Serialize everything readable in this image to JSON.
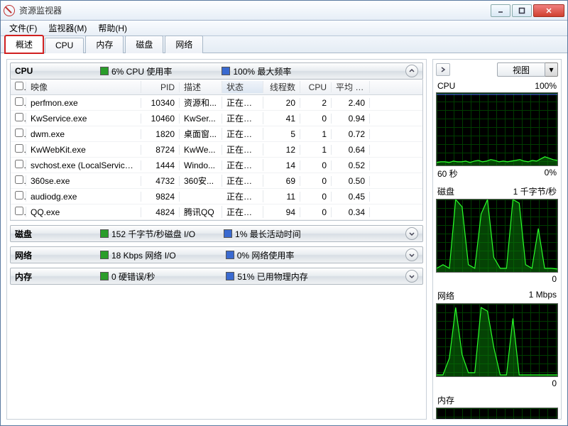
{
  "window": {
    "title": "资源监视器"
  },
  "menu": {
    "file": "文件(F)",
    "monitor": "监视器(M)",
    "help": "帮助(H)"
  },
  "tabs": {
    "overview": "概述",
    "cpu": "CPU",
    "memory": "内存",
    "disk": "磁盘",
    "network": "网络"
  },
  "cpu_section": {
    "name": "CPU",
    "usage_label": "6% CPU 使用率",
    "freq_label": "100% 最大频率",
    "columns": {
      "image": "映像",
      "pid": "PID",
      "desc": "描述",
      "status": "状态",
      "threads": "线程数",
      "cpu": "CPU",
      "avg": "平均 C..."
    },
    "rows": [
      {
        "image": "perfmon.exe",
        "pid": "10340",
        "desc": "资源和...",
        "status": "正在运行",
        "threads": "20",
        "cpu": "2",
        "avg": "2.40"
      },
      {
        "image": "KwService.exe",
        "pid": "10460",
        "desc": "KwSer...",
        "status": "正在运行",
        "threads": "41",
        "cpu": "0",
        "avg": "0.94"
      },
      {
        "image": "dwm.exe",
        "pid": "1820",
        "desc": "桌面窗...",
        "status": "正在运行",
        "threads": "5",
        "cpu": "1",
        "avg": "0.72"
      },
      {
        "image": "KwWebKit.exe",
        "pid": "8724",
        "desc": "KwWe...",
        "status": "正在运行",
        "threads": "12",
        "cpu": "1",
        "avg": "0.64"
      },
      {
        "image": "svchost.exe (LocalServiceN...",
        "pid": "1444",
        "desc": "Windo...",
        "status": "正在运行",
        "threads": "14",
        "cpu": "0",
        "avg": "0.52"
      },
      {
        "image": "360se.exe",
        "pid": "4732",
        "desc": "360安...",
        "status": "正在运行",
        "threads": "69",
        "cpu": "0",
        "avg": "0.50"
      },
      {
        "image": "audiodg.exe",
        "pid": "9824",
        "desc": "",
        "status": "正在运行",
        "threads": "11",
        "cpu": "0",
        "avg": "0.45"
      },
      {
        "image": "QQ.exe",
        "pid": "4824",
        "desc": "腾讯QQ",
        "status": "正在运行",
        "threads": "94",
        "cpu": "0",
        "avg": "0.34"
      }
    ]
  },
  "disk_section": {
    "name": "磁盘",
    "io_label": "152 千字节/秒磁盘 I/O",
    "active_label": "1% 最长活动时间"
  },
  "net_section": {
    "name": "网络",
    "io_label": "18 Kbps 网络 I/O",
    "use_label": "0% 网络使用率"
  },
  "mem_section": {
    "name": "内存",
    "fault_label": "0 硬错误/秒",
    "used_label": "51% 已用物理内存"
  },
  "right": {
    "view_label": "视图",
    "graphs": {
      "cpu": {
        "title": "CPU",
        "right": "100%",
        "foot_l": "60 秒",
        "foot_r": "0%"
      },
      "disk": {
        "title": "磁盘",
        "right": "1 千字节/秒",
        "foot_l": "",
        "foot_r": "0"
      },
      "net": {
        "title": "网络",
        "right": "1 Mbps",
        "foot_l": "",
        "foot_r": "0"
      },
      "mem": {
        "title": "内存",
        "right": ""
      }
    }
  },
  "chart_data": [
    {
      "type": "line",
      "title": "CPU",
      "ylim": [
        0,
        100
      ],
      "xrange_seconds": 60,
      "series": [
        {
          "name": "CPU 使用率",
          "values": [
            4,
            5,
            5,
            4,
            6,
            5,
            5,
            6,
            4,
            6,
            7,
            5,
            6,
            8,
            7,
            5,
            6,
            5,
            6,
            7,
            8,
            6,
            5,
            7,
            6,
            9,
            12,
            10,
            8,
            7
          ]
        },
        {
          "name": "最大频率",
          "values": [
            100,
            100,
            100,
            100,
            100,
            100,
            100,
            100,
            100,
            100,
            100,
            100,
            100,
            100,
            100,
            100,
            100,
            100,
            100,
            100,
            100,
            100,
            100,
            100,
            100,
            100,
            100,
            100,
            100,
            100
          ]
        }
      ]
    },
    {
      "type": "line",
      "title": "磁盘",
      "ylabel": "千字节/秒",
      "ylim": [
        0,
        1
      ],
      "series": [
        {
          "name": "磁盘 I/O",
          "values": [
            0.05,
            0.1,
            0.05,
            1.0,
            0.9,
            0.1,
            0.05,
            0.8,
            1.0,
            0.2,
            0.05,
            0.05,
            1.0,
            0.95,
            0.1,
            0.05,
            0.6,
            0.05,
            0.05,
            0.04
          ]
        }
      ]
    },
    {
      "type": "line",
      "title": "网络",
      "ylabel": "Mbps",
      "ylim": [
        0,
        1
      ],
      "series": [
        {
          "name": "网络 I/O",
          "values": [
            0.02,
            0.02,
            0.25,
            0.95,
            0.3,
            0.05,
            0.05,
            0.95,
            0.9,
            0.4,
            0.02,
            0.02,
            0.8,
            0.02,
            0.02,
            0.02,
            0.02,
            0.02,
            0.02,
            0.02
          ]
        }
      ]
    }
  ]
}
